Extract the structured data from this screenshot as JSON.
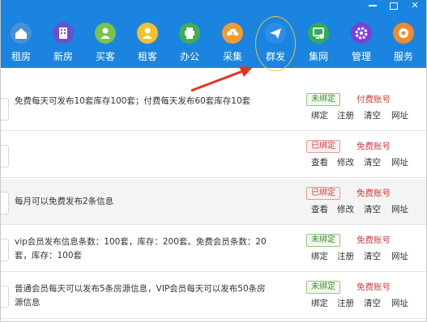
{
  "nav": {
    "items": [
      {
        "label": "租房",
        "icon": "house-icon",
        "color": "#4a90d9"
      },
      {
        "label": "新房",
        "icon": "building-icon",
        "color": "#6a4fd0"
      },
      {
        "label": "买客",
        "icon": "person-icon",
        "color": "#7ac24e"
      },
      {
        "label": "租客",
        "icon": "person-icon",
        "color": "#f2c12e"
      },
      {
        "label": "办公",
        "icon": "printer-icon",
        "color": "#3fae55"
      },
      {
        "label": "采集",
        "icon": "cloud-download-icon",
        "color": "#f39a35"
      },
      {
        "label": "群发",
        "icon": "send-icon",
        "color": "#2d8de6"
      },
      {
        "label": "集网",
        "icon": "network-icon",
        "color": "#2fae57"
      },
      {
        "label": "管理",
        "icon": "gear-icon",
        "color": "#7a3fd6"
      },
      {
        "label": "服务",
        "icon": "service-icon",
        "color": "#f28a2c"
      }
    ]
  },
  "rows": [
    {
      "desc": "免费每天可发布10套库存100套；付费每天发布60套库存10套",
      "status": "未绑定",
      "status_type": "unbound",
      "account": "付费账号",
      "actions": [
        "绑定",
        "注册",
        "清空",
        "网址"
      ]
    },
    {
      "desc": "",
      "status": "已绑定",
      "status_type": "bound",
      "account": "免费账号",
      "actions": [
        "查看",
        "修改",
        "清空",
        "网址"
      ]
    },
    {
      "desc": "每月可以免费发布2条信息",
      "status": "已绑定",
      "status_type": "bound",
      "account": "免费账号",
      "actions": [
        "查看",
        "修改",
        "清空",
        "网址"
      ]
    },
    {
      "desc": "vip会员发布信息条数：100套，库存：200套。免费会员条数：20套，库存：100套",
      "status": "未绑定",
      "status_type": "unbound",
      "account": "免费账号",
      "actions": [
        "绑定",
        "注册",
        "清空",
        "网址"
      ]
    },
    {
      "desc": "普通会员每天可以发布5条房源信息，VIP会员每天可以发布50条房源信息",
      "status": "未绑定",
      "status_type": "unbound",
      "account": "免费账号",
      "actions": [
        "绑定",
        "注册",
        "清空",
        "网址"
      ]
    }
  ],
  "colors": {
    "accent": "#1a84e0",
    "highlight": "#f0c040",
    "arrow": "#e8321e"
  }
}
